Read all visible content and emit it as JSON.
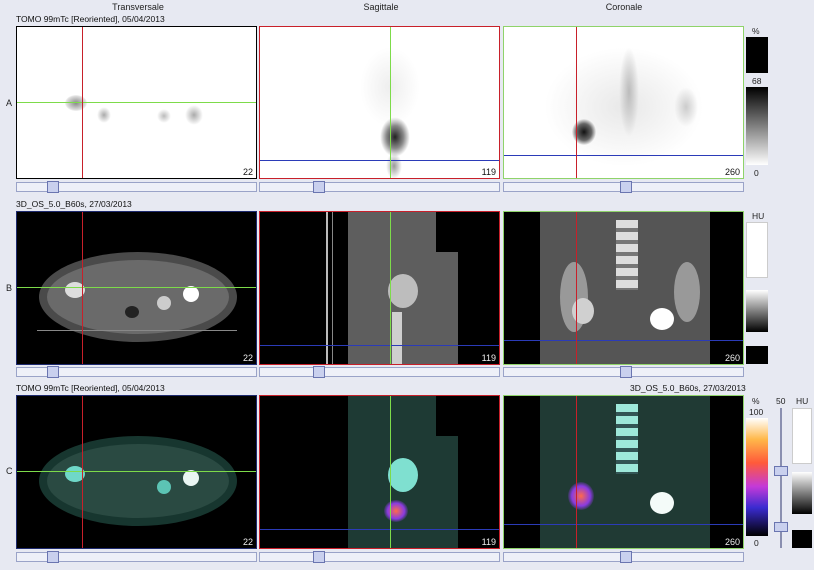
{
  "columns": {
    "transversale": "Transversale",
    "sagittale": "Sagittale",
    "coronale": "Coronale"
  },
  "rows": {
    "a": {
      "label": "A",
      "header": "TOMO 99mTc [Reoriented], 05/04/2013",
      "slices": [
        "22",
        "119",
        "260"
      ]
    },
    "b": {
      "label": "B",
      "header": "3D_OS_5.0_B60s, 27/03/2013",
      "slices": [
        "22",
        "119",
        "260"
      ]
    },
    "c": {
      "label": "C",
      "header_left": "TOMO 99mTc [Reoriented], 05/04/2013",
      "header_right": "3D_OS_5.0_B60s, 27/03/2013",
      "slices": [
        "22",
        "119",
        "260"
      ]
    }
  },
  "scales": {
    "a": {
      "unit": "%",
      "top": "68",
      "bottom": "0"
    },
    "b": {
      "unit": "HU"
    },
    "c": {
      "unit": "%",
      "top": "100",
      "bottom": "0",
      "fusion": "50",
      "hu_unit": "HU"
    }
  },
  "colors": {
    "crosshair_red": "#c8202a",
    "crosshair_green": "#7ddb4a",
    "crosshair_blue": "#2b3bb8",
    "background": "#e7e9f2"
  }
}
